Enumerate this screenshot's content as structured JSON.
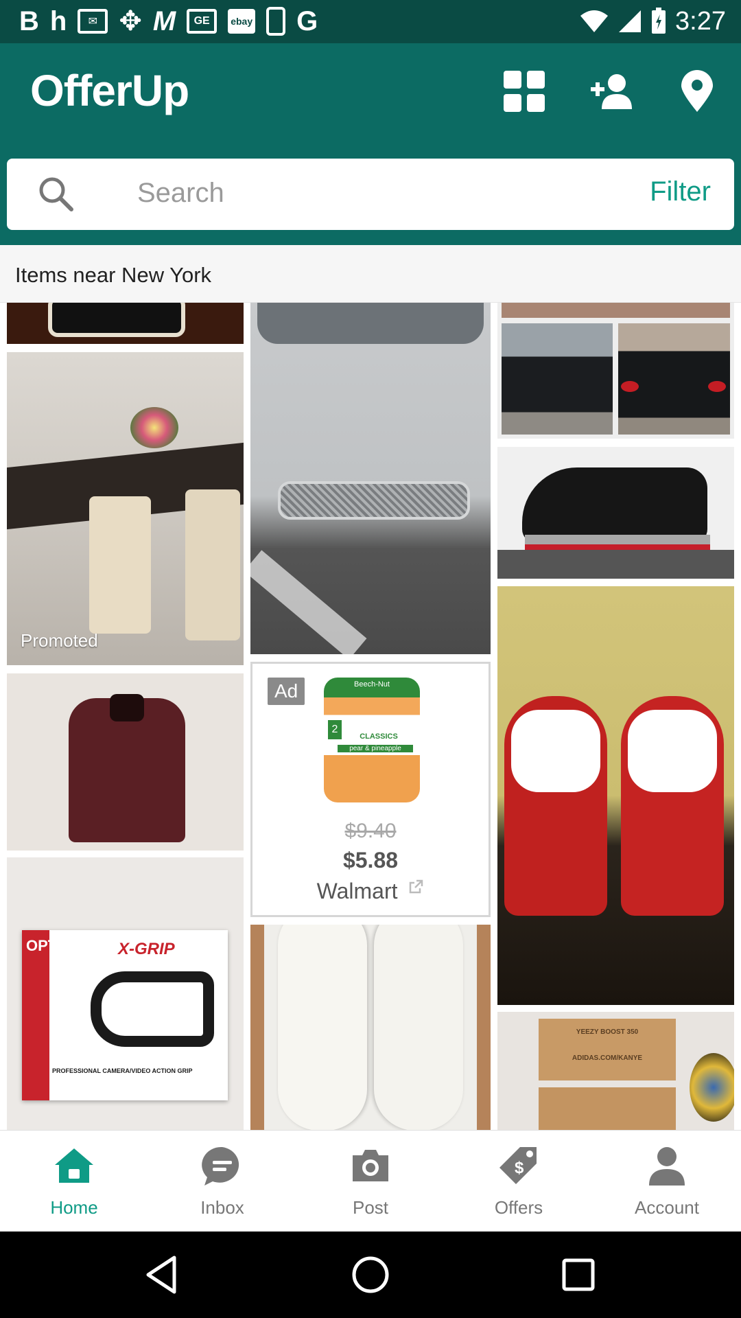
{
  "status_bar": {
    "icons": [
      "B",
      "h",
      "mail-icon",
      "dropbox-icon",
      "M",
      "GE",
      "ebay",
      "phone-icon",
      "G"
    ],
    "ebay_label": "ebay",
    "ge_label": "GE",
    "time": "3:27"
  },
  "header": {
    "logo": "OfferUp",
    "icons": [
      "grid-icon",
      "add-person-icon",
      "location-pin-icon"
    ]
  },
  "search": {
    "placeholder": "Search",
    "filter_label": "Filter"
  },
  "section": {
    "title": "Items near New York"
  },
  "listings": {
    "promoted_label": "Promoted",
    "ad": {
      "badge": "Ad",
      "old_price": "$9.40",
      "price": "$5.88",
      "store": "Walmart",
      "product_brand": "Beech-Nut",
      "product_line": "CLASSICS",
      "product_flavor": "pear & pineapple",
      "stage": "2"
    },
    "grip_brand": "OPTEKA",
    "grip_name": "X-GRIP",
    "grip_caption": "PROFESSIONAL CAMERA/VIDEO ACTION GRIP",
    "box_label_1": "YEEZY BOOST 350",
    "box_label_2": "ADIDAS.COM/KANYE"
  },
  "bottom_nav": {
    "items": [
      {
        "label": "Home",
        "icon": "home-icon",
        "active": true
      },
      {
        "label": "Inbox",
        "icon": "chat-icon",
        "active": false
      },
      {
        "label": "Post",
        "icon": "camera-icon",
        "active": false
      },
      {
        "label": "Offers",
        "icon": "price-tag-icon",
        "active": false
      },
      {
        "label": "Account",
        "icon": "person-icon",
        "active": false
      }
    ]
  },
  "colors": {
    "header": "#0c6b63",
    "status_bar": "#0a4b44",
    "accent": "#0f9b86"
  }
}
